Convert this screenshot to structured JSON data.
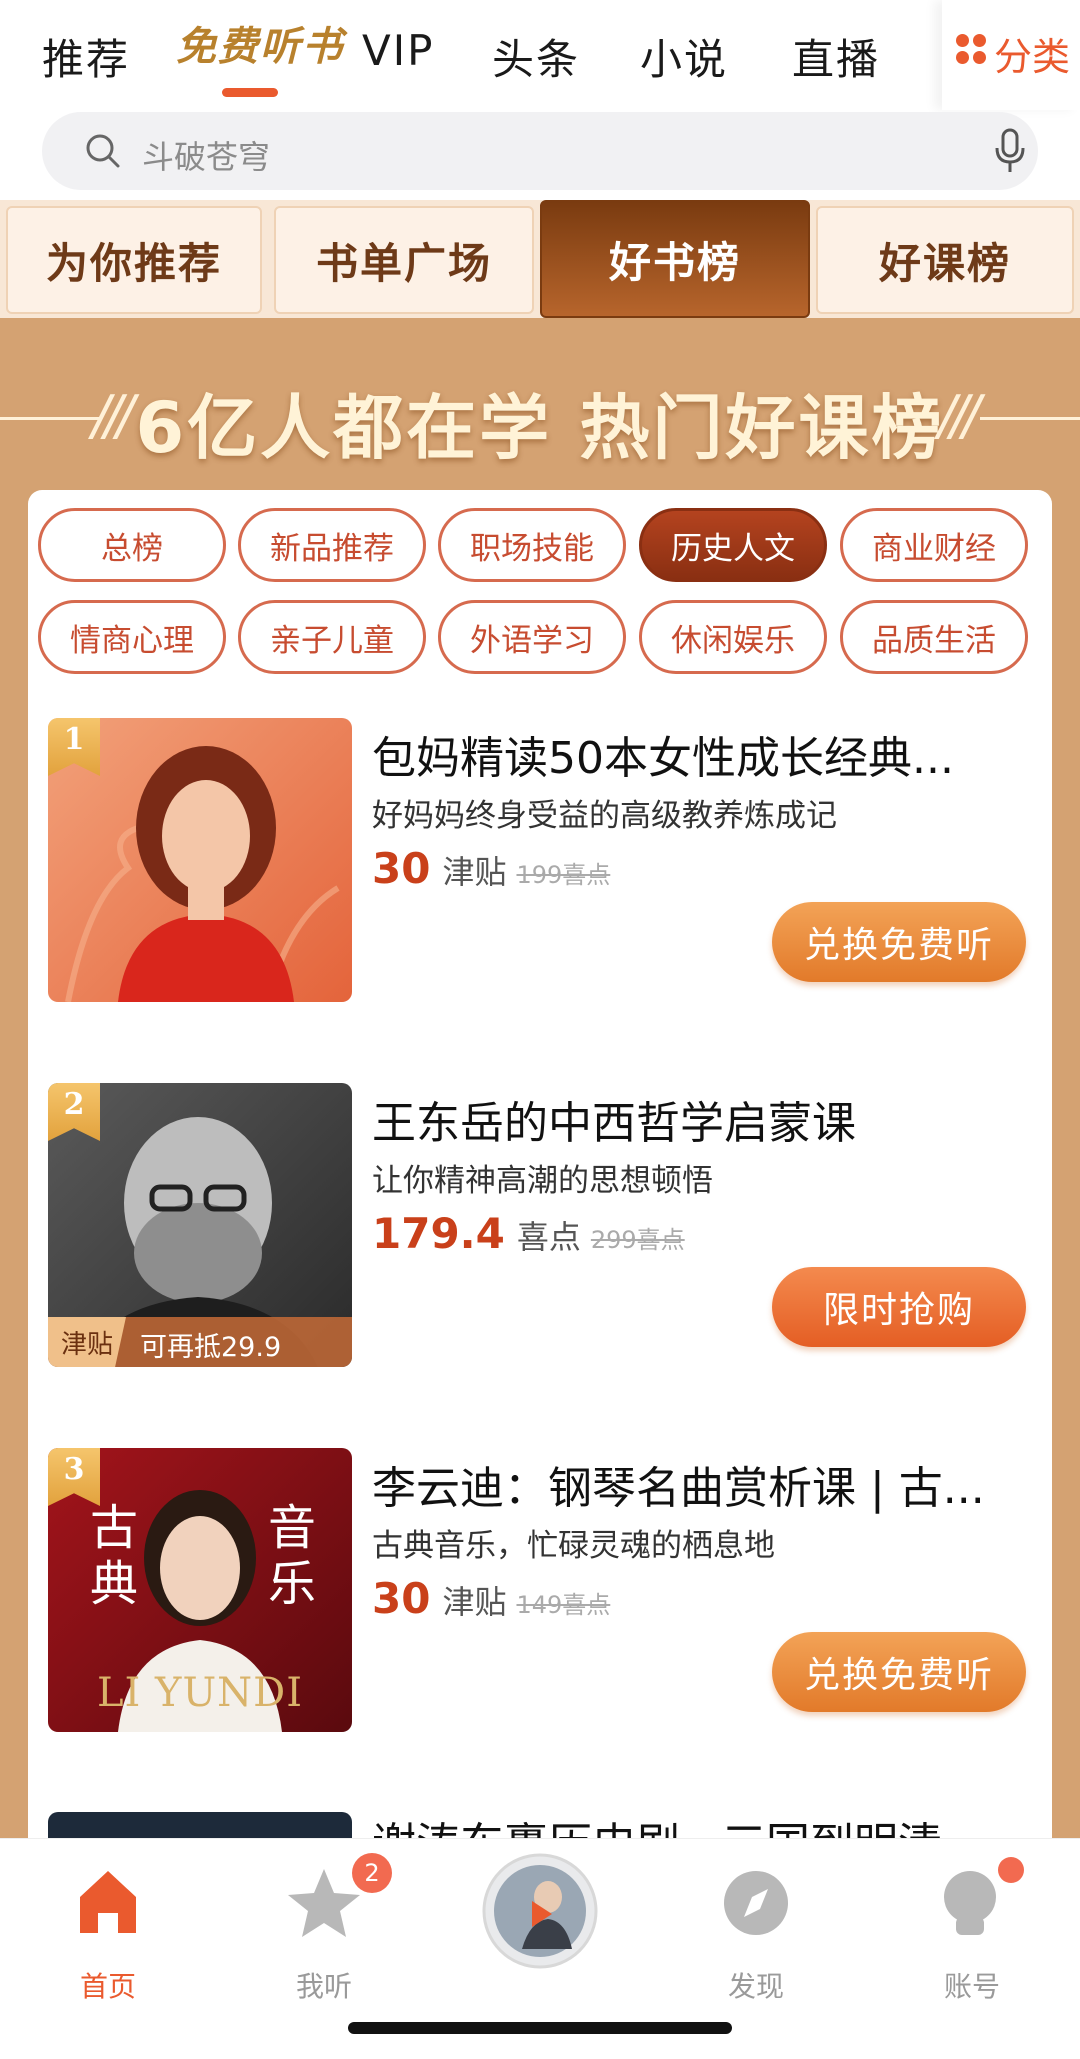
{
  "top_tabs": [
    "推荐",
    "免费听书",
    "VIP",
    "头条",
    "小说",
    "直播"
  ],
  "category_label": "分类",
  "search_placeholder": "斗破苍穹",
  "segments": [
    "为你推荐",
    "书单广场",
    "好书榜",
    "好课榜"
  ],
  "active_segment": "好书榜",
  "banner_title": "6亿人都在学 热门好课榜",
  "chips": [
    "总榜",
    "新品推荐",
    "职场技能",
    "历史人文",
    "商业财经",
    "情商心理",
    "亲子儿童",
    "外语学习",
    "休闲娱乐",
    "品质生活"
  ],
  "active_chip": "历史人文",
  "items": [
    {
      "rank": "1",
      "title": "包妈精读50本女性成长经典...",
      "subtitle": "好妈妈终身受益的高级教养炼成记",
      "price": "30",
      "unit": "津贴",
      "original": "199喜点",
      "button": "兑换免费听"
    },
    {
      "rank": "2",
      "title": "王东岳的中西哲学启蒙课",
      "subtitle": "让你精神高潮的思想顿悟",
      "price": "179.4",
      "unit": "喜点",
      "original": "299喜点",
      "button": "限时抢购",
      "tag_a": "津贴",
      "tag_b": "可再抵29.9"
    },
    {
      "rank": "3",
      "title": "李云迪：钢琴名曲赏析课 | 古...",
      "subtitle": "古典音乐，忙碌灵魂的栖息地",
      "price": "30",
      "unit": "津贴",
      "original": "149喜点",
      "button": "兑换免费听",
      "cover_text_left": "古典",
      "cover_text_right": "音乐",
      "cover_name": "LI YUNDI"
    }
  ],
  "partial_title": "谢涛东裹历史剧...三国到明清",
  "bottom_tabs": [
    {
      "label": "首页",
      "active": true
    },
    {
      "label": "我听",
      "badge": "2"
    },
    {
      "label": "",
      "center": true
    },
    {
      "label": "发现"
    },
    {
      "label": "账号"
    }
  ],
  "colors": {
    "accent": "#ea5a2e",
    "brown_bg": "#d4a272",
    "chip_border": "#d66a4e",
    "price": "#c9401a"
  }
}
